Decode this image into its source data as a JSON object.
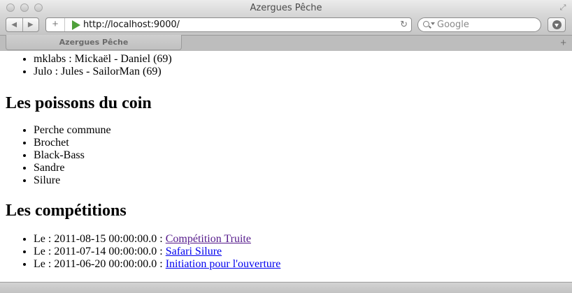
{
  "window": {
    "title": "Azergues Pêche"
  },
  "toolbar": {
    "url": "http://localhost:9000/",
    "search_placeholder": "Google"
  },
  "tabs": [
    {
      "label": "Azergues Pêche"
    }
  ],
  "page": {
    "members": [
      "mklabs : Mickaël - Daniel (69)",
      "Julo : Jules - SailorMan (69)"
    ],
    "fish_heading": "Les poissons du coin",
    "fish": [
      "Perche commune",
      "Brochet",
      "Black-Bass",
      "Sandre",
      "Silure"
    ],
    "competitions_heading": "Les compétitions",
    "competitions": [
      {
        "prefix": "Le : 2011-08-15 00:00:00.0 : ",
        "link": "Compétition Truite",
        "visited": true
      },
      {
        "prefix": "Le : 2011-07-14 00:00:00.0 : ",
        "link": "Safari Silure",
        "visited": false
      },
      {
        "prefix": "Le : 2011-06-20 00:00:00.0 : ",
        "link": "Initiation pour l'ouverture",
        "visited": false
      }
    ]
  },
  "colors": {
    "link": "#0000ee",
    "visited_link": "#551a8b",
    "play_icon": "#4fa03a"
  }
}
